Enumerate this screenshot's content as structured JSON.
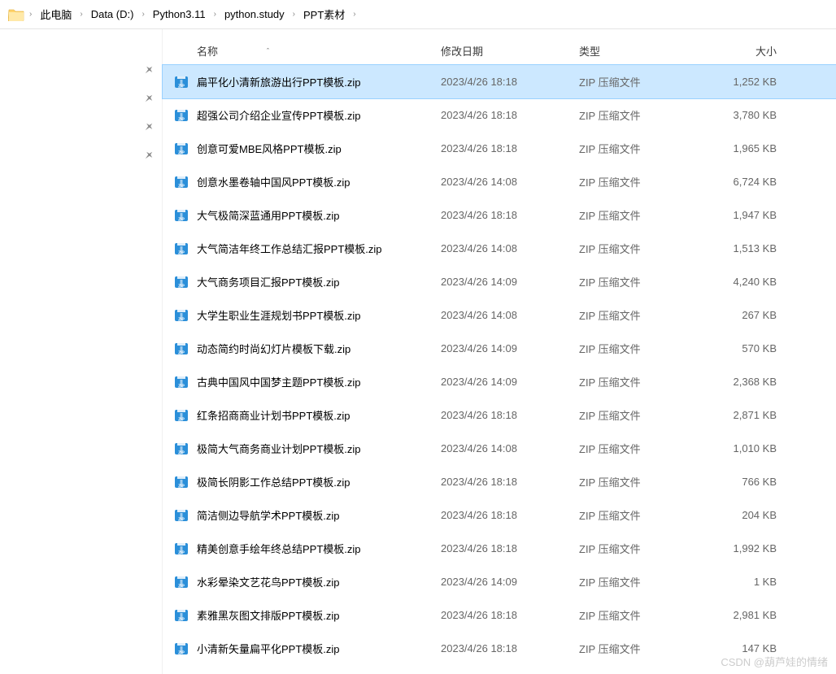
{
  "breadcrumb": [
    "此电脑",
    "Data (D:)",
    "Python3.11",
    "python.study",
    "PPT素材"
  ],
  "columns": {
    "name": "名称",
    "date": "修改日期",
    "type": "类型",
    "size": "大小"
  },
  "files": [
    {
      "name": "扁平化小清新旅游出行PPT模板.zip",
      "date": "2023/4/26 18:18",
      "type": "ZIP 压缩文件",
      "size": "1,252 KB",
      "selected": true
    },
    {
      "name": "超强公司介绍企业宣传PPT模板.zip",
      "date": "2023/4/26 18:18",
      "type": "ZIP 压缩文件",
      "size": "3,780 KB"
    },
    {
      "name": "创意可爱MBE风格PPT模板.zip",
      "date": "2023/4/26 18:18",
      "type": "ZIP 压缩文件",
      "size": "1,965 KB"
    },
    {
      "name": "创意水墨卷轴中国风PPT模板.zip",
      "date": "2023/4/26 14:08",
      "type": "ZIP 压缩文件",
      "size": "6,724 KB"
    },
    {
      "name": "大气极简深蓝通用PPT模板.zip",
      "date": "2023/4/26 18:18",
      "type": "ZIP 压缩文件",
      "size": "1,947 KB"
    },
    {
      "name": "大气简洁年终工作总结汇报PPT模板.zip",
      "date": "2023/4/26 14:08",
      "type": "ZIP 压缩文件",
      "size": "1,513 KB"
    },
    {
      "name": "大气商务项目汇报PPT模板.zip",
      "date": "2023/4/26 14:09",
      "type": "ZIP 压缩文件",
      "size": "4,240 KB"
    },
    {
      "name": "大学生职业生涯规划书PPT模板.zip",
      "date": "2023/4/26 14:08",
      "type": "ZIP 压缩文件",
      "size": "267 KB"
    },
    {
      "name": "动态简约时尚幻灯片模板下载.zip",
      "date": "2023/4/26 14:09",
      "type": "ZIP 压缩文件",
      "size": "570 KB"
    },
    {
      "name": "古典中国风中国梦主题PPT模板.zip",
      "date": "2023/4/26 14:09",
      "type": "ZIP 压缩文件",
      "size": "2,368 KB"
    },
    {
      "name": "红条招商商业计划书PPT模板.zip",
      "date": "2023/4/26 18:18",
      "type": "ZIP 压缩文件",
      "size": "2,871 KB"
    },
    {
      "name": "极简大气商务商业计划PPT模板.zip",
      "date": "2023/4/26 14:08",
      "type": "ZIP 压缩文件",
      "size": "1,010 KB"
    },
    {
      "name": "极简长阴影工作总结PPT模板.zip",
      "date": "2023/4/26 18:18",
      "type": "ZIP 压缩文件",
      "size": "766 KB"
    },
    {
      "name": "简洁侧边导航学术PPT模板.zip",
      "date": "2023/4/26 18:18",
      "type": "ZIP 压缩文件",
      "size": "204 KB"
    },
    {
      "name": "精美创意手绘年终总结PPT模板.zip",
      "date": "2023/4/26 18:18",
      "type": "ZIP 压缩文件",
      "size": "1,992 KB"
    },
    {
      "name": "水彩晕染文艺花鸟PPT模板.zip",
      "date": "2023/4/26 14:09",
      "type": "ZIP 压缩文件",
      "size": "1 KB"
    },
    {
      "name": "素雅黑灰图文排版PPT模板.zip",
      "date": "2023/4/26 18:18",
      "type": "ZIP 压缩文件",
      "size": "2,981 KB"
    },
    {
      "name": "小清新矢量扁平化PPT模板.zip",
      "date": "2023/4/26 18:18",
      "type": "ZIP 压缩文件",
      "size": "147 KB"
    }
  ],
  "watermark": "CSDN @葫芦娃的情绪"
}
